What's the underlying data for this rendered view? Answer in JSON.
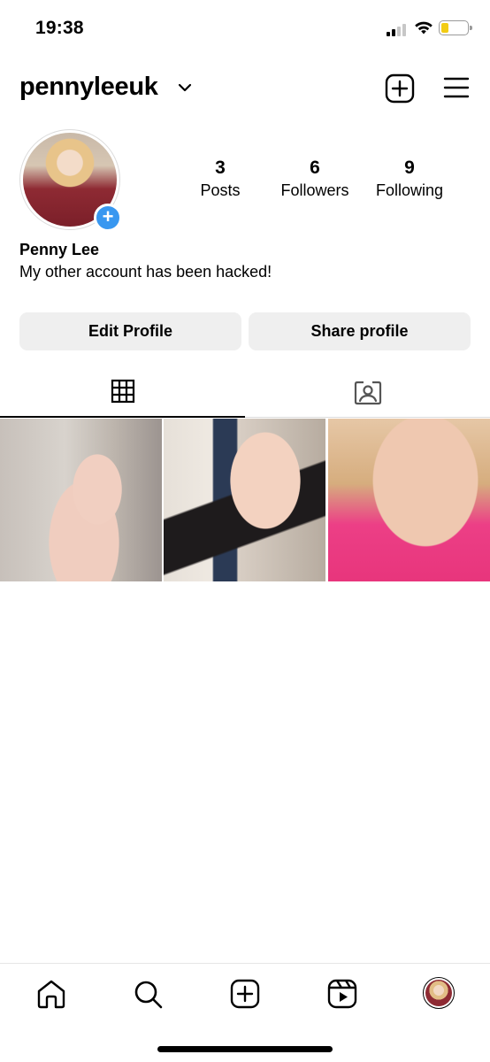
{
  "status_bar": {
    "time": "19:38",
    "icons": [
      "cellular-signal-icon",
      "wifi-icon",
      "battery-icon"
    ],
    "battery_color": "#f2cc14"
  },
  "header": {
    "username": "pennyleeuk",
    "icons": [
      "chevron-down-icon",
      "add-post-icon",
      "menu-icon"
    ]
  },
  "profile": {
    "display_name": "Penny Lee",
    "bio": "My other account has been hacked!",
    "stats": {
      "posts": {
        "value": "3",
        "label": "Posts"
      },
      "followers": {
        "value": "6",
        "label": "Followers"
      },
      "following": {
        "value": "9",
        "label": "Following"
      }
    },
    "avatar_add_symbol": "+",
    "accent_color": "#3897f0"
  },
  "actions": {
    "edit_profile": "Edit Profile",
    "share_profile": "Share profile"
  },
  "tabs": [
    {
      "icon": "grid-icon",
      "selected": true
    },
    {
      "icon": "tagged-icon",
      "selected": false
    }
  ],
  "posts": [
    {
      "id": 1,
      "description_icon": "photo"
    },
    {
      "id": 2,
      "description_icon": "photo"
    },
    {
      "id": 3,
      "description_icon": "photo"
    }
  ],
  "bottom_nav": {
    "items": [
      "home-icon",
      "search-icon",
      "create-icon",
      "reels-icon",
      "profile-avatar"
    ]
  }
}
